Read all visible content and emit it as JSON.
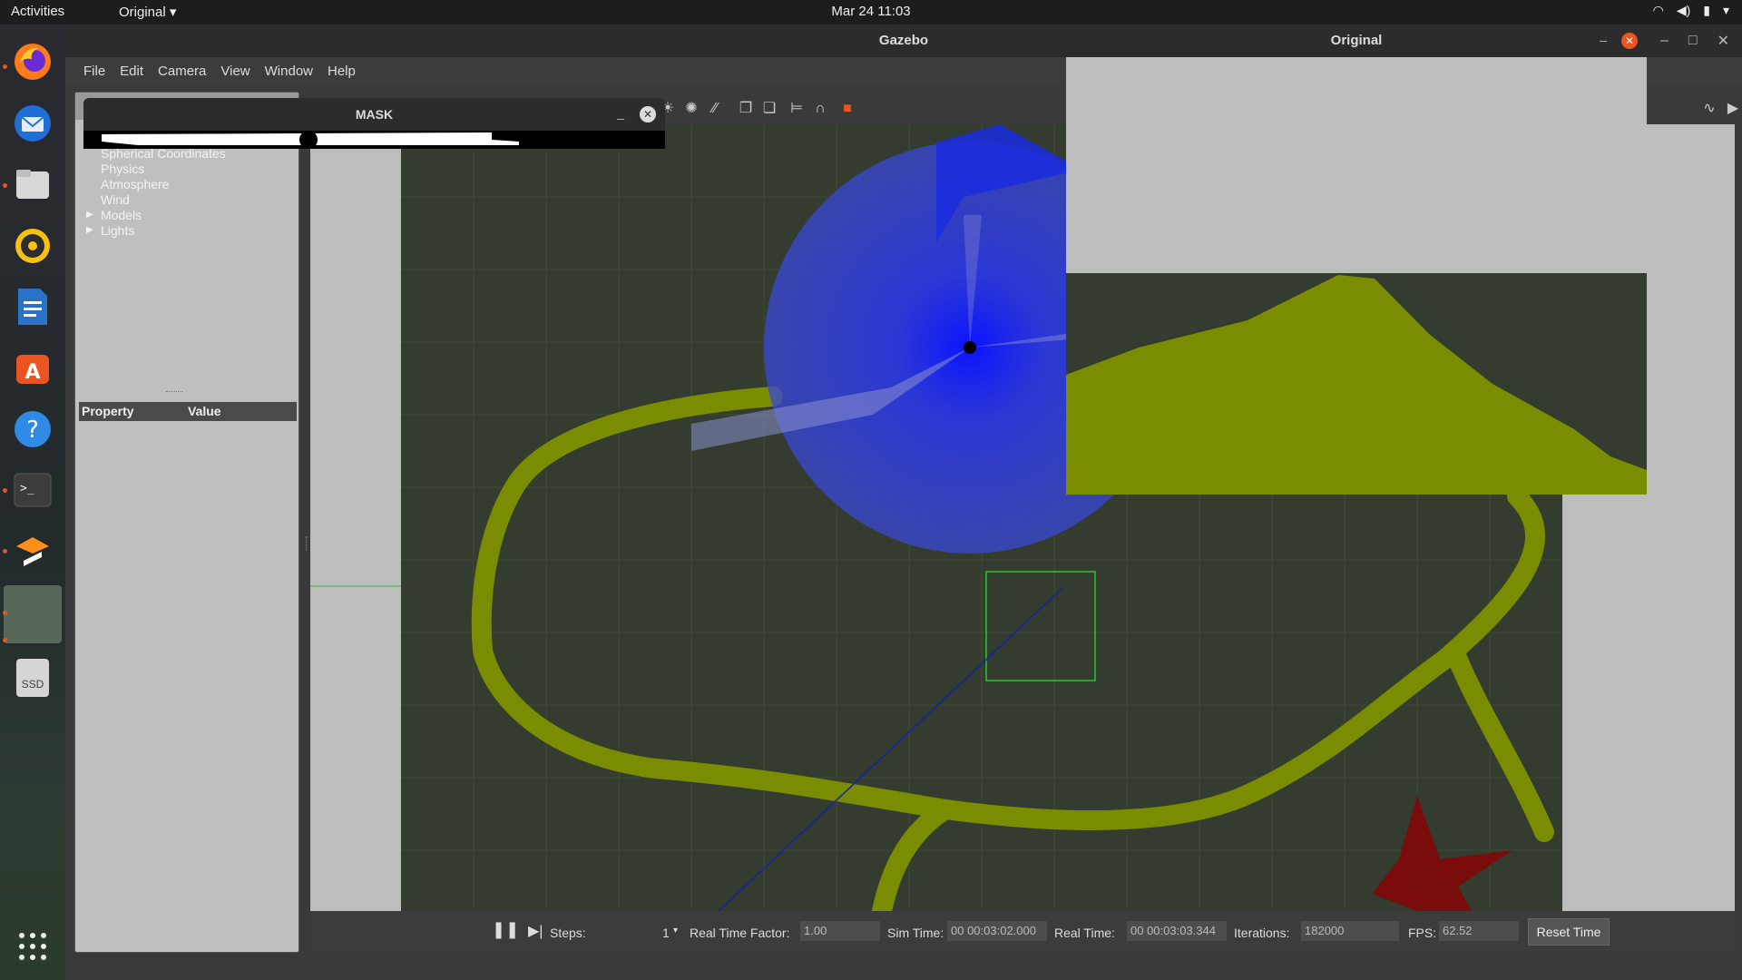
{
  "topbar": {
    "activities": "Activities",
    "app_menu": "Original ▾",
    "clock": "Mar 24  11:03",
    "tray_icons": [
      "wifi-icon",
      "volume-icon",
      "battery-icon",
      "power-menu-icon"
    ]
  },
  "dock": {
    "items": [
      {
        "name": "firefox-icon",
        "running": true
      },
      {
        "name": "thunderbird-icon",
        "running": false
      },
      {
        "name": "files-icon",
        "running": true
      },
      {
        "name": "rhythmbox-icon",
        "running": false
      },
      {
        "name": "libreoffice-writer-icon",
        "running": false
      },
      {
        "name": "software-center-icon",
        "running": false
      },
      {
        "name": "help-icon",
        "running": false
      },
      {
        "name": "terminal-icon",
        "running": true
      },
      {
        "name": "sublime-text-icon",
        "running": true
      },
      {
        "name": "gazebo-icon",
        "running": true
      },
      {
        "name": "ssd-drive-icon",
        "running": false,
        "label": "SSD"
      },
      {
        "name": "app-grid-icon",
        "running": false
      }
    ]
  },
  "gazebo": {
    "title": "Gazebo",
    "menu": [
      "File",
      "Edit",
      "Camera",
      "View",
      "Window",
      "Help"
    ],
    "world_tree": {
      "items": [
        "Spherical Coordinates",
        "Physics",
        "Atmosphere",
        "Wind"
      ],
      "expandable": [
        "Models",
        "Lights"
      ]
    },
    "property_header": {
      "property": "Property",
      "value": "Value"
    },
    "bottom_bar": {
      "steps_label": "Steps:",
      "steps_value": "1",
      "rtf_label": "Real Time Factor:",
      "rtf_value": "1.00",
      "sim_time_label": "Sim Time:",
      "sim_time_value": "00 00:03:02.000",
      "real_time_label": "Real Time:",
      "real_time_value": "00 00:03:03.344",
      "iterations_label": "Iterations:",
      "iterations_value": "182000",
      "fps_label": "FPS:",
      "fps_value": "62.52",
      "reset_label": "Reset Time"
    }
  },
  "mask_window": {
    "title": "MASK"
  },
  "original_window": {
    "title": "Original"
  },
  "colors": {
    "ground": "#333c2e",
    "track": "#7a8c00",
    "laser": "#1a2be0",
    "star": "#7a0c0c",
    "accent": "#e95420"
  }
}
